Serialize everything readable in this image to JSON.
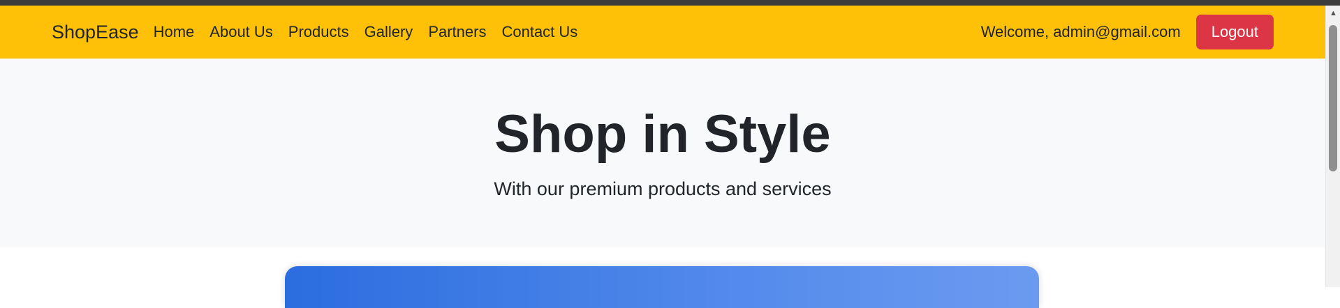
{
  "navbar": {
    "brand": "ShopEase",
    "links": [
      {
        "label": "Home"
      },
      {
        "label": "About Us"
      },
      {
        "label": "Products"
      },
      {
        "label": "Gallery"
      },
      {
        "label": "Partners"
      },
      {
        "label": "Contact Us"
      }
    ],
    "welcome_text": "Welcome, admin@gmail.com",
    "logout_label": "Logout"
  },
  "hero": {
    "title": "Shop in Style",
    "subtitle": "With our premium products and services"
  },
  "colors": {
    "navbar_bg": "#ffc107",
    "logout_bg": "#dc3545",
    "hero_bg": "#f8f9fa",
    "card_gradient_start": "#2b6ddf",
    "card_gradient_end": "#6a9bf0"
  },
  "icons": {
    "scroll_up": "chevron-up-icon"
  }
}
